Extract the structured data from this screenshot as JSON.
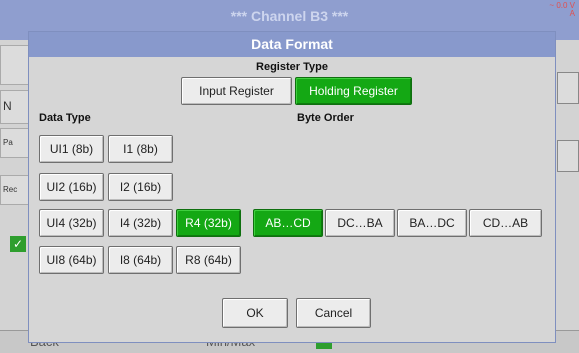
{
  "background": {
    "title": "*** Channel B3 ***",
    "top_right_value": "~ 0.0 V",
    "top_right_unit": "A",
    "left_tabs": [
      "",
      "N",
      "Pa",
      "Rec"
    ],
    "bottom_labels": [
      "Back",
      "Min/Max"
    ]
  },
  "dialog": {
    "title": "Data Format",
    "register_type_label": "Register Type",
    "register_types": [
      {
        "label": "Input Register",
        "selected": false
      },
      {
        "label": "Holding Register",
        "selected": true
      }
    ],
    "data_type_label": "Data Type",
    "byte_order_label": "Byte Order",
    "data_types": [
      {
        "label": "UI1 (8b)",
        "selected": false
      },
      {
        "label": "I1 (8b)",
        "selected": false
      },
      {
        "label": "UI2 (16b)",
        "selected": false
      },
      {
        "label": "I2 (16b)",
        "selected": false
      },
      {
        "label": "UI4 (32b)",
        "selected": false
      },
      {
        "label": "I4 (32b)",
        "selected": false
      },
      {
        "label": "R4 (32b)",
        "selected": true
      },
      {
        "label": "UI8 (64b)",
        "selected": false
      },
      {
        "label": "I8 (64b)",
        "selected": false
      },
      {
        "label": "R8 (64b)",
        "selected": false
      }
    ],
    "byte_orders": [
      {
        "label": "AB…CD",
        "selected": true
      },
      {
        "label": "DC…BA",
        "selected": false
      },
      {
        "label": "BA…DC",
        "selected": false
      },
      {
        "label": "CD…AB",
        "selected": false
      }
    ],
    "ok_label": "OK",
    "cancel_label": "Cancel"
  },
  "colors": {
    "header": "#8899cc",
    "selected": "#14a814"
  }
}
